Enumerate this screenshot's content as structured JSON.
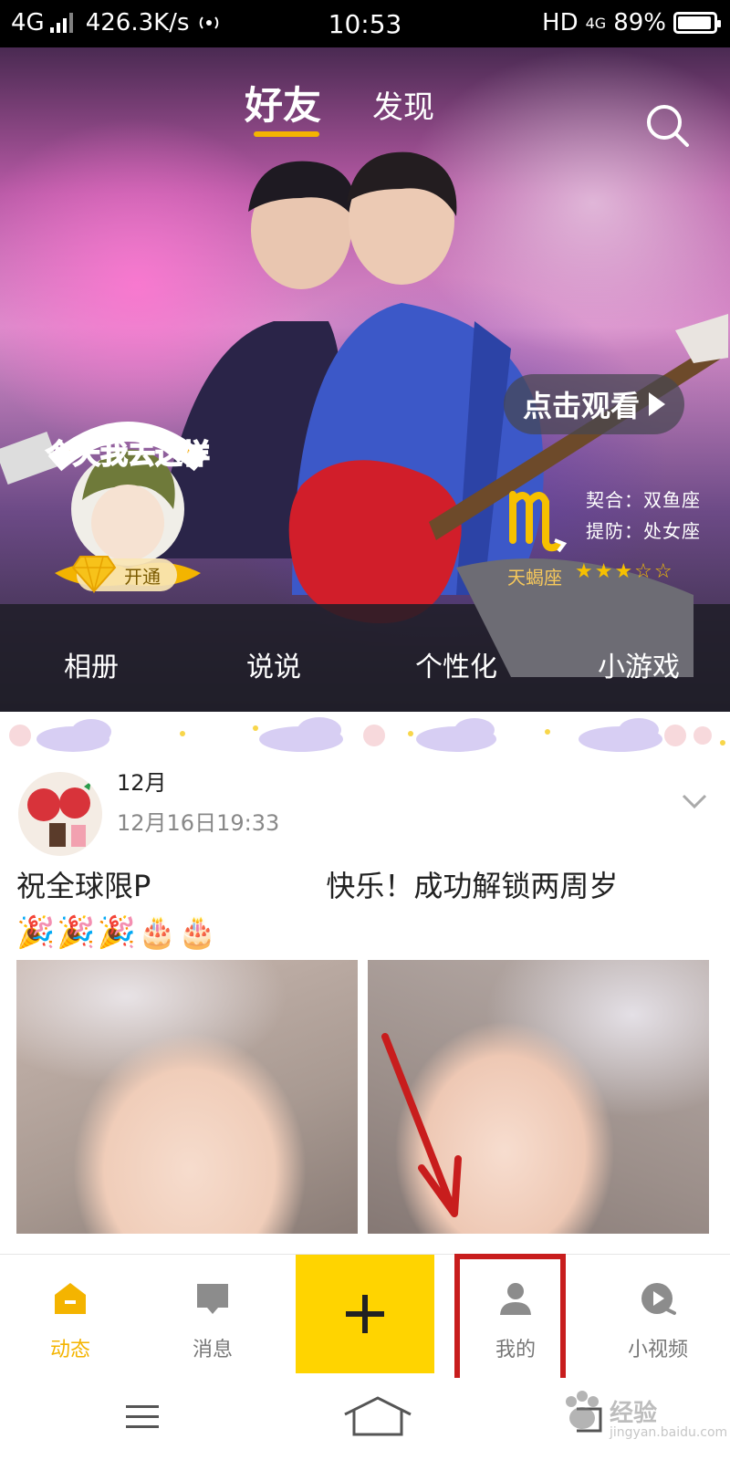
{
  "status_bar": {
    "network": "4G",
    "speed": "426.3K/s",
    "time": "10:53",
    "hd": "HD",
    "network_right": "4G",
    "battery": "89%"
  },
  "top_tabs": {
    "friends": "好友",
    "discover": "发现"
  },
  "banner": {
    "watch_label": "点击观看",
    "zodiac": {
      "compat": "契合：双鱼座",
      "beware": "提防：处女座",
      "name": "天蝎座",
      "stars": "★★★☆☆"
    },
    "pendant_text": "今天我去这样",
    "open_label": "开通",
    "menu": [
      "相册",
      "说说",
      "个性化",
      "小游戏"
    ]
  },
  "post": {
    "name": "12月",
    "time": "12月16日19:33",
    "text_start": "祝全球限P",
    "text_end": "快乐！成功解锁两周岁",
    "emoji": "🎉🎉🎉🎂🎂"
  },
  "bottom_nav": {
    "items": [
      {
        "label": "动态"
      },
      {
        "label": "消息"
      },
      {
        "label": "我的"
      },
      {
        "label": "小视频"
      }
    ]
  },
  "watermark": {
    "text": "经验",
    "url": "jingyan.baidu.com"
  },
  "colors": {
    "accent": "#f4b400",
    "plus_button": "#ffd400",
    "highlight": "#c81d1d"
  }
}
